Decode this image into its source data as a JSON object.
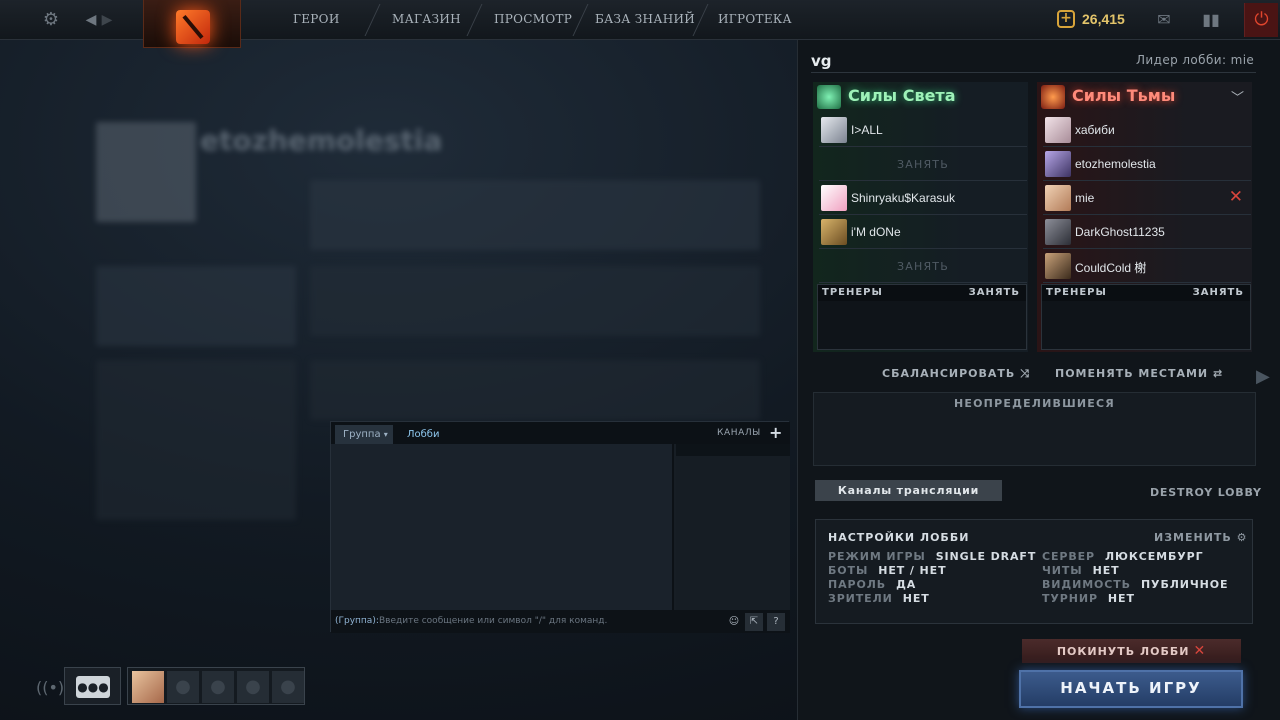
{
  "nav": {
    "items": [
      "ГЕРОИ",
      "МАГАЗИН",
      "ПРОСМОТР",
      "БАЗА ЗНАНИЙ",
      "ИГРОТЕКА"
    ],
    "gold": "26,415"
  },
  "background": {
    "profile_name": "etozhemolestia"
  },
  "chat": {
    "tab_group": "Группа",
    "tab_lobby": "Лобби",
    "channels_label": "КАНАЛЫ",
    "input_prefix": "(Группа):",
    "input_placeholder": "Введите сообщение или символ \"/\" для команд.",
    "help_label": "?"
  },
  "lobby": {
    "name": "vg",
    "leader": "Лидер лобби: mie",
    "radiant": {
      "title": "Силы Света",
      "players": [
        "I>ALL",
        "Shinryaku$Karasuk",
        "i'M dONe"
      ],
      "take_label": "ЗАНЯТЬ"
    },
    "dire": {
      "title": "Силы Тьмы",
      "players": [
        "хабиби",
        "etozhemolestia",
        "mie",
        "DarkGhost11235",
        "CouldCold 榭"
      ]
    },
    "coaches_label": "ТРЕНЕРЫ",
    "coaches_take": "ЗАНЯТЬ",
    "balance_label": "СБАЛАНСИРОВАТЬ",
    "swap_label": "ПОМЕНЯТЬ МЕСТАМИ",
    "undecided_label": "НЕОПРЕДЕЛИВШИЕСЯ",
    "broadcast_label": "Каналы трансляции",
    "destroy_label": "DESTROY LOBBY",
    "settings": {
      "title": "НАСТРОЙКИ ЛОББИ",
      "edit_label": "ИЗМЕНИТЬ",
      "left": [
        {
          "label": "РЕЖИМ ИГРЫ",
          "value": "SINGLE DRAFT"
        },
        {
          "label": "БОТЫ",
          "value": "НЕТ / НЕТ"
        },
        {
          "label": "ПАРОЛЬ",
          "value": "ДА"
        },
        {
          "label": "ЗРИТЕЛИ",
          "value": "НЕТ"
        }
      ],
      "right": [
        {
          "label": "СЕРВЕР",
          "value": "ЛЮКСЕМБУРГ"
        },
        {
          "label": "ЧИТЫ",
          "value": "НЕТ"
        },
        {
          "label": "ВИДИМОСТЬ",
          "value": "ПУБЛИЧНОЕ"
        },
        {
          "label": "ТУРНИР",
          "value": "НЕТ"
        }
      ]
    },
    "leave_label": "ПОКИНУТЬ ЛОББИ",
    "start_label": "НАЧАТЬ ИГРУ"
  },
  "colors": {
    "radiant": "#9ef2b8",
    "dire": "#ff8a7a",
    "gold": "#e3c46a",
    "start_button": "#2d4e82"
  }
}
